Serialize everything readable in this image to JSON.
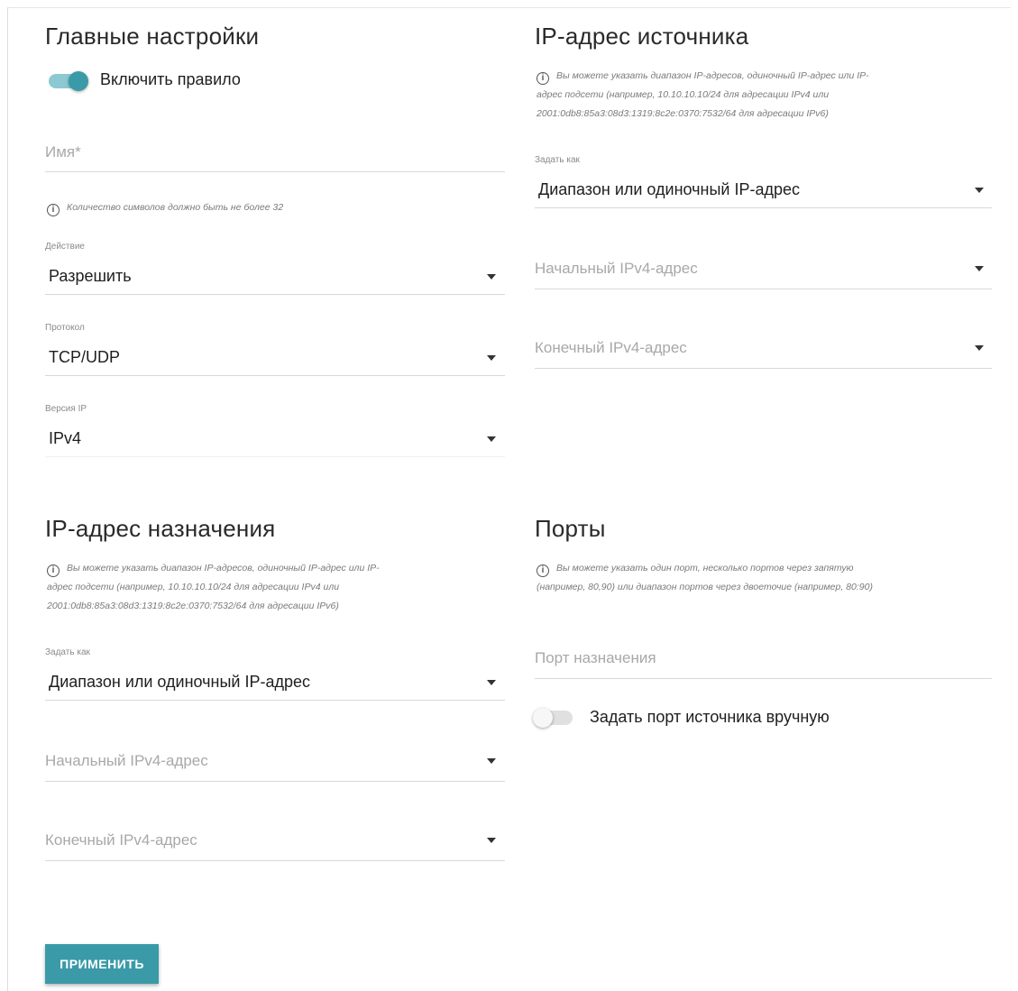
{
  "colors": {
    "accent": "#3a9aa8",
    "toggle_on_track": "#8cc9d2",
    "toggle_off_track": "#e0e0e0"
  },
  "main": {
    "title": "Главные настройки",
    "enable_rule": {
      "label": "Включить правило",
      "state": "on"
    },
    "name": {
      "placeholder": "Имя*",
      "hint": "Количество символов должно быть не более 32"
    },
    "action": {
      "label": "Действие",
      "value": "Разрешить"
    },
    "protocol": {
      "label": "Протокол",
      "value": "TCP/UDP"
    },
    "ip_version": {
      "label": "Версия IP",
      "value": "IPv4"
    }
  },
  "source": {
    "title": "IP-адрес источника",
    "hint_lines": [
      "Вы можете указать диапазон IP-адресов, одиночный IP-адрес или IP-",
      "адрес подсети (например, 10.10.10.10/24 для адресации IPv4 или",
      "2001:0db8:85a3:08d3:1319:8c2e:0370:7532/64 для адресации IPv6)"
    ],
    "set_as": {
      "label": "Задать как",
      "value": "Диапазон или одиночный IP-адрес"
    },
    "start_ip": {
      "placeholder": "Начальный IPv4-адрес"
    },
    "end_ip": {
      "placeholder": "Конечный IPv4-адрес"
    }
  },
  "destination": {
    "title": "IP-адрес назначения",
    "hint_lines": [
      "Вы можете указать диапазон IP-адресов, одиночный IP-адрес или IP-",
      "адрес подсети (например, 10.10.10.10/24 для адресации IPv4 или",
      "2001:0db8:85a3:08d3:1319:8c2e:0370:7532/64 для адресации IPv6)"
    ],
    "set_as": {
      "label": "Задать как",
      "value": "Диапазон или одиночный IP-адрес"
    },
    "start_ip": {
      "placeholder": "Начальный IPv4-адрес"
    },
    "end_ip": {
      "placeholder": "Конечный IPv4-адрес"
    }
  },
  "ports": {
    "title": "Порты",
    "hint_lines": [
      "Вы можете указать один порт, несколько портов через запятую",
      "(например, 80,90) или диапазон портов через двоеточие (например, 80:90)"
    ],
    "dest_port": {
      "placeholder": "Порт назначения"
    },
    "manual_source": {
      "label": "Задать порт источника вручную",
      "state": "off"
    }
  },
  "apply_button": "ПРИМЕНИТЬ"
}
